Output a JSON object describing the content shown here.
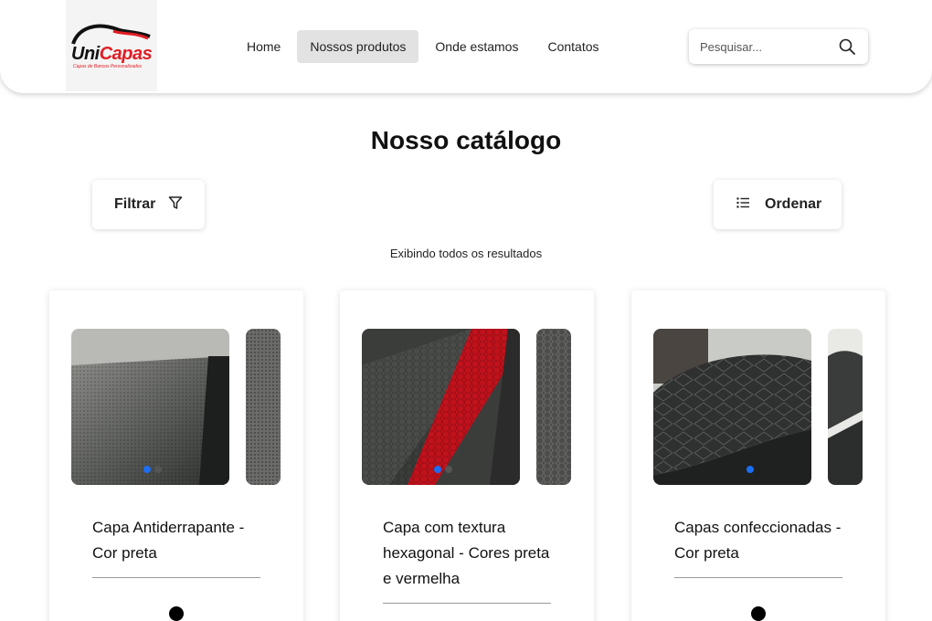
{
  "brand": {
    "name_a": "Uni",
    "name_b": "Capas",
    "tagline": "Capas de Bancos Personalizados"
  },
  "nav": {
    "items": [
      {
        "label": "Home",
        "active": false
      },
      {
        "label": "Nossos produtos",
        "active": true
      },
      {
        "label": "Onde estamos",
        "active": false
      },
      {
        "label": "Contatos",
        "active": false
      }
    ]
  },
  "search": {
    "placeholder": "Pesquisar...",
    "icon": "search-icon"
  },
  "catalog": {
    "title": "Nosso catálogo",
    "filter_label": "Filtrar",
    "filter_icon": "filter-icon",
    "order_label": "Ordenar",
    "order_icon": "list-icon",
    "results_text": "Exibindo todos os resultados"
  },
  "products": [
    {
      "title": "Capa Antiderrapante - Cor preta",
      "slides": 2,
      "active_slide": 1
    },
    {
      "title": "Capa com textura hexagonal - Cores preta e vermelha",
      "slides": 2,
      "active_slide": 1
    },
    {
      "title": "Capas confeccionadas - Cor preta",
      "slides": 1,
      "active_slide": 1
    }
  ],
  "colors": {
    "accent": "#1c6ef2",
    "brand_red": "#e11d24",
    "nav_active_bg": "#e2e2e2"
  }
}
